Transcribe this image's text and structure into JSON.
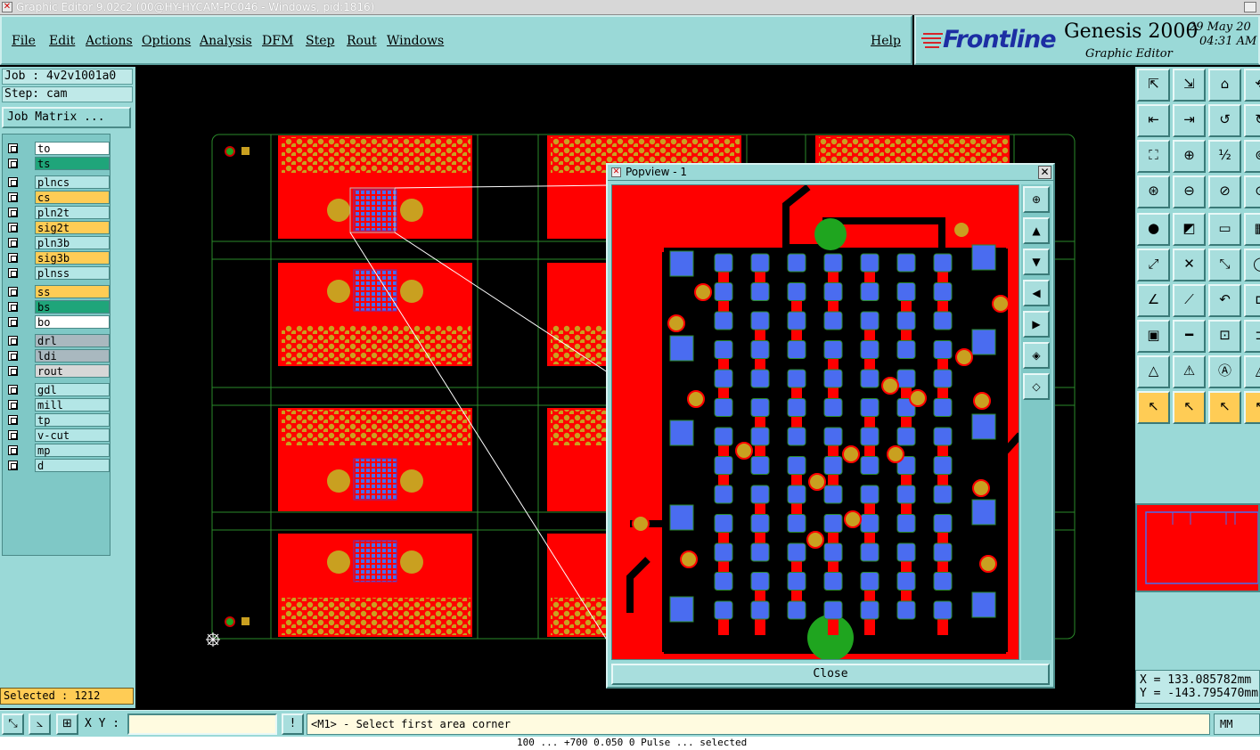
{
  "window": {
    "title": "Graphic Editor 9.02c2 (00@HY-HYCAM-PC046 - Windows, pid:1816)"
  },
  "menu": {
    "file": "File",
    "edit": "Edit",
    "actions": "Actions",
    "options": "Options",
    "analysis": "Analysis",
    "dfm": "DFM",
    "step": "Step",
    "rout": "Rout",
    "windows": "Windows",
    "help": "Help"
  },
  "brand": {
    "logo": "Frontline",
    "product": "Genesis 2000",
    "subtitle": "Graphic Editor",
    "date": "29 May 20",
    "time": "04:31 AM"
  },
  "job": {
    "job": "Job : 4v2v1001a0",
    "step": "Step: cam",
    "matrix_button": "Job Matrix ..."
  },
  "layers": [
    {
      "name": "to",
      "color": "#ffffff"
    },
    {
      "name": "ts",
      "color": "#1fa57a"
    },
    {
      "name": "plncs",
      "color": "#b3e6e6"
    },
    {
      "name": "cs",
      "color": "#ffcc55"
    },
    {
      "name": "pln2t",
      "color": "#b3e6e6"
    },
    {
      "name": "sig2t",
      "color": "#ffcc55"
    },
    {
      "name": "pln3b",
      "color": "#b3e6e6"
    },
    {
      "name": "sig3b",
      "color": "#ffcc55"
    },
    {
      "name": "plnss",
      "color": "#b3e6e6"
    },
    {
      "name": "ss",
      "color": "#ffcc55"
    },
    {
      "name": "bs",
      "color": "#1fa57a"
    },
    {
      "name": "bo",
      "color": "#ffffff"
    },
    {
      "name": "drl",
      "color": "#a9b8bf"
    },
    {
      "name": "ldi",
      "color": "#a9b8bf"
    },
    {
      "name": "rout",
      "color": "#d7d7d7"
    },
    {
      "name": "gdl",
      "color": "#b3e6e6"
    },
    {
      "name": "mill",
      "color": "#b3e6e6"
    },
    {
      "name": "tp",
      "color": "#b3e6e6"
    },
    {
      "name": "v-cut",
      "color": "#b3e6e6"
    },
    {
      "name": "mp",
      "color": "#b3e6e6"
    },
    {
      "name": "d",
      "color": "#b3e6e6"
    }
  ],
  "selected": "Selected : 1212",
  "popview": {
    "title": "Popview - 1",
    "close": "Close"
  },
  "coords": {
    "x": "X = 133.085782mm",
    "y": "Y = -143.795470mm"
  },
  "status": {
    "xy_label": "X Y :",
    "xy_value": "",
    "prompt": "<M1> - Select first area corner",
    "units": "MM",
    "bottom": "100 ... +700 0.050 0 Pulse ... selected"
  },
  "colors": {
    "copper": "#ff0000",
    "pad": "#4a6cf0",
    "via": "#c9a020",
    "panel": "#9ad9d7",
    "selection": "#ffcc55"
  }
}
